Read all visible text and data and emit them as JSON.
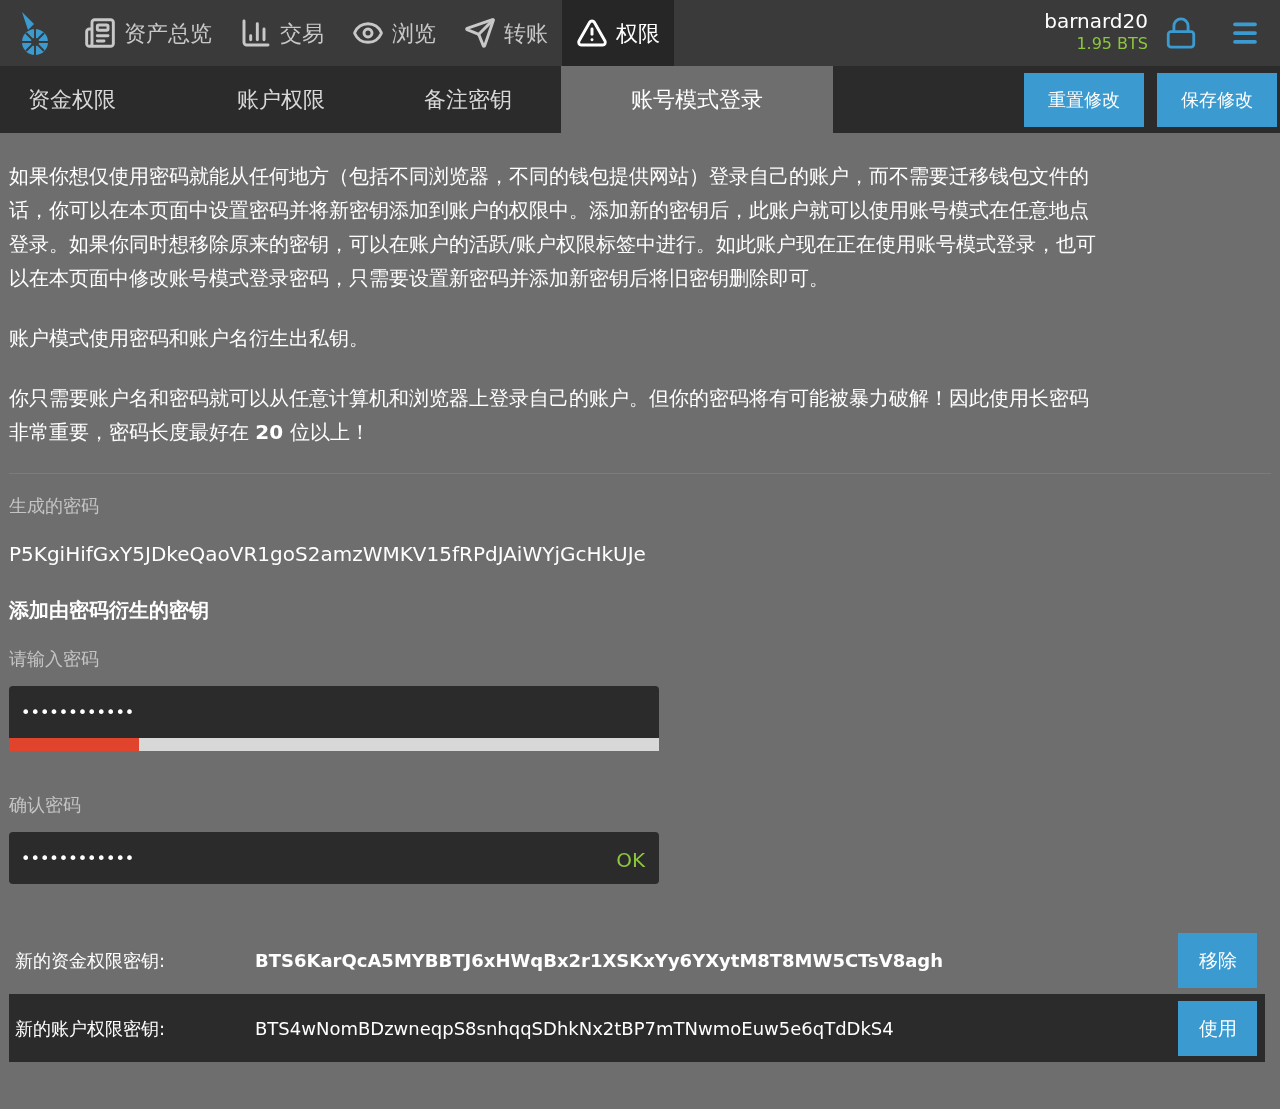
{
  "top_nav": [
    {
      "label": "资产总览",
      "selected": false
    },
    {
      "label": "交易",
      "selected": false
    },
    {
      "label": "浏览",
      "selected": false
    },
    {
      "label": "转账",
      "selected": false
    },
    {
      "label": "权限",
      "selected": true
    }
  ],
  "account": {
    "name": "barnard20",
    "balance": "1.95 BTS"
  },
  "sub_tabs": [
    {
      "label": "资金权限",
      "selected": false
    },
    {
      "label": "账户权限",
      "selected": false
    },
    {
      "label": "备注密钥",
      "selected": false
    },
    {
      "label": "账号模式登录",
      "selected": true
    }
  ],
  "actions": [
    "重置修改",
    "保存修改"
  ],
  "paragraphs": [
    "如果你想仅使用密码就能从任何地方（包括不同浏览器，不同的钱包提供网站）登录自己的账户，而不需要迁移钱包文件的话，你可以在本页面中设置密码并将新密钥添加到账户的权限中。添加新的密钥后，此账户就可以使用账号模式在任意地点登录。如果你同时想移除原来的密钥，可以在账户的活跃/账户权限标签中进行。如此账户现在正在使用账号模式登录，也可以在本页面中修改账号模式登录密码，只需要设置新密码并添加新密钥后将旧密钥删除即可。",
    "账户模式使用密码和账户名衍生出私钥。",
    "你只需要账户名和密码就可以从任意计算机和浏览器上登录自己的账户。但你的密码将有可能被暴力破解！因此使用长密码非常重要，密码长度最好在 **20** 位以上！"
  ],
  "generated": {
    "label": "生成的密码",
    "value": "P5KgiHifGxY5JDkeQaoVR1goS2amzWMKV15fRPdJAiWYjGcHkUJe"
  },
  "section_title": "添加由密码衍生的密钥",
  "password": {
    "label": "请输入密码",
    "value": "••••••••••••",
    "strength": {
      "level": 0.2
    }
  },
  "confirm": {
    "label": "确认密码",
    "value": "••••••••••••",
    "status": "OK"
  },
  "keys": [
    {
      "kind": "added",
      "label": "新的资金权限密钥:",
      "key": "BTS6KarQcA5MYBBTJ6xHWqBx2r1XSKxYy6YXytM8T8MW5CTsV8agh",
      "button": "移除"
    },
    {
      "kind": "available",
      "label": "新的账户权限密钥:",
      "key": "BTS4wNomBDzwneqpS8snhqqSDhkNx2tBP7mTNwmoEuw5e6qTdDkS4",
      "button": "使用"
    }
  ]
}
